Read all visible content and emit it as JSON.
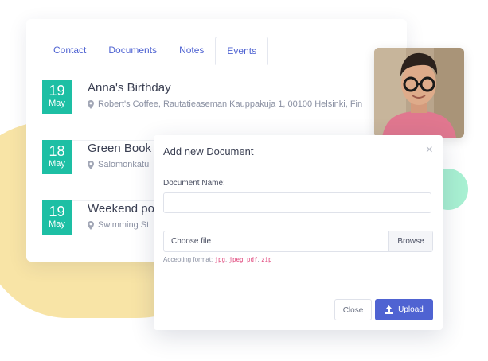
{
  "tabs": [
    {
      "label": "Contact",
      "active": false
    },
    {
      "label": "Documents",
      "active": false
    },
    {
      "label": "Notes",
      "active": false
    },
    {
      "label": "Events",
      "active": true
    }
  ],
  "events": [
    {
      "day": "19",
      "month": "May",
      "title": "Anna's Birthday",
      "location": "Robert's Coffee, Rautatieaseman Kauppakuja 1, 00100 Helsinki, Fin"
    },
    {
      "day": "18",
      "month": "May",
      "title": "Green Book",
      "location": "Salomonkatu"
    },
    {
      "day": "19",
      "month": "May",
      "title": "Weekend po",
      "location": "Swimming St"
    }
  ],
  "modal": {
    "title": "Add new Document",
    "close_symbol": "×",
    "name_label": "Document Name:",
    "name_value": "",
    "file_label": "Choose file",
    "browse_label": "Browse",
    "formats_label": "Accepting format:",
    "formats": [
      "jpg",
      "jpeg",
      "pdf",
      "zip"
    ],
    "close_button": "Close",
    "upload_button": "Upload"
  },
  "colors": {
    "accent": "#4f63d2",
    "date_badge": "#1dbfa4",
    "blob_yellow": "#f8e4a6",
    "blob_green": "#a8f0d2"
  }
}
